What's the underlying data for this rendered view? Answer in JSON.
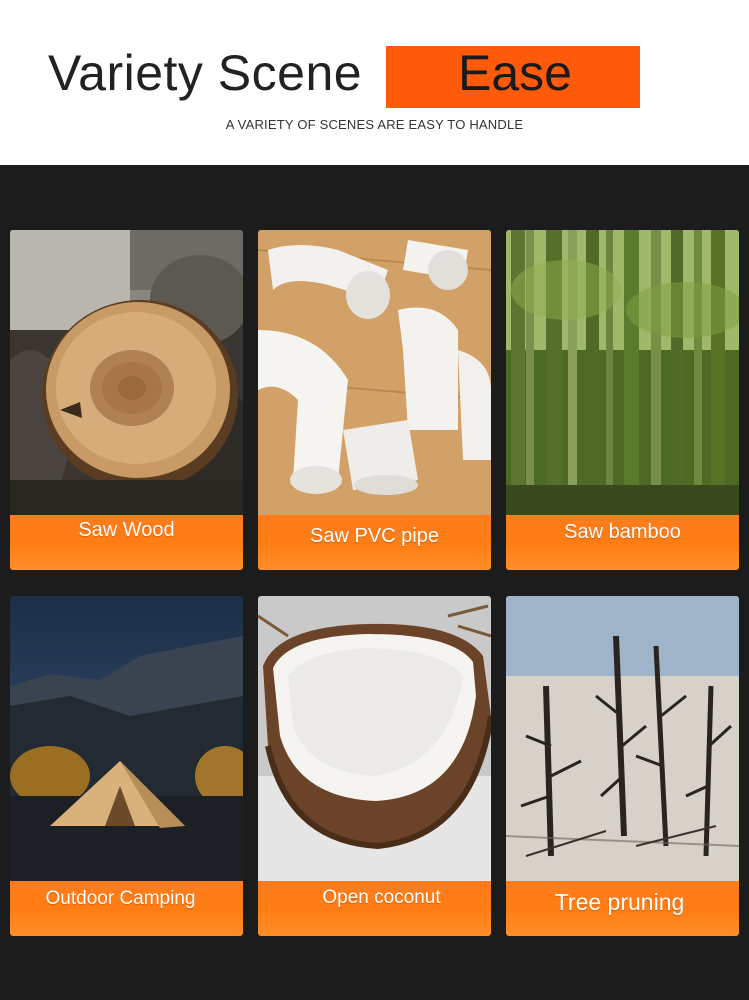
{
  "header": {
    "title_left": "Variety Scene",
    "title_highlight": "Ease",
    "subtitle": "A VARIETY OF SCENES ARE EASY TO HANDLE"
  },
  "scenes": [
    {
      "label": "Saw Wood",
      "icon": "wood-log-photo"
    },
    {
      "label": "Saw PVC pipe",
      "icon": "pvc-pipe-photo"
    },
    {
      "label": "Saw bamboo",
      "icon": "bamboo-photo"
    },
    {
      "label": "Outdoor Camping",
      "icon": "camping-photo"
    },
    {
      "label": "Open coconut",
      "icon": "coconut-photo"
    },
    {
      "label": "Tree pruning",
      "icon": "dead-tree-photo"
    }
  ],
  "colors": {
    "accent": "#ff5a0a",
    "background": "#1c1c1c",
    "header_bg": "#ffffff"
  }
}
